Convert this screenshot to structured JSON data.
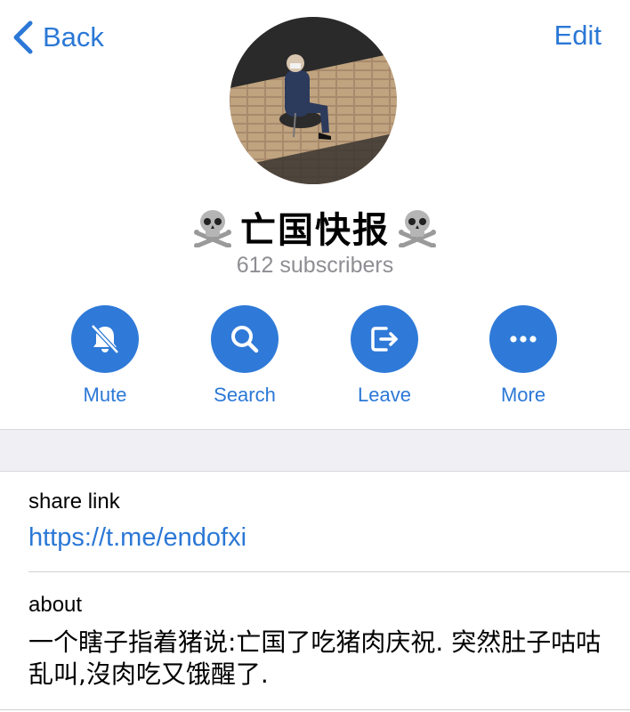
{
  "nav": {
    "back_label": "Back",
    "edit_label": "Edit"
  },
  "channel": {
    "title": "亡国快报",
    "title_emoji": "skull-and-crossbones",
    "subscribers": "612 subscribers"
  },
  "actions": [
    {
      "label": "Mute",
      "icon": "bell-slash-icon"
    },
    {
      "label": "Search",
      "icon": "search-icon"
    },
    {
      "label": "Leave",
      "icon": "leave-icon"
    },
    {
      "label": "More",
      "icon": "more-icon"
    }
  ],
  "info": {
    "share_link_label": "share link",
    "share_link_value": "https://t.me/endofxi",
    "about_label": "about",
    "about_value": "一个瞎子指着猪说:亡国了吃猪肉庆祝. 突然肚子咕咕乱叫,沒肉吃又饿醒了."
  },
  "colors": {
    "accent": "#2b78d6",
    "action_circle": "#2f7ad8",
    "secondary_text": "#8e8e93",
    "separator_band": "#efeff4"
  }
}
